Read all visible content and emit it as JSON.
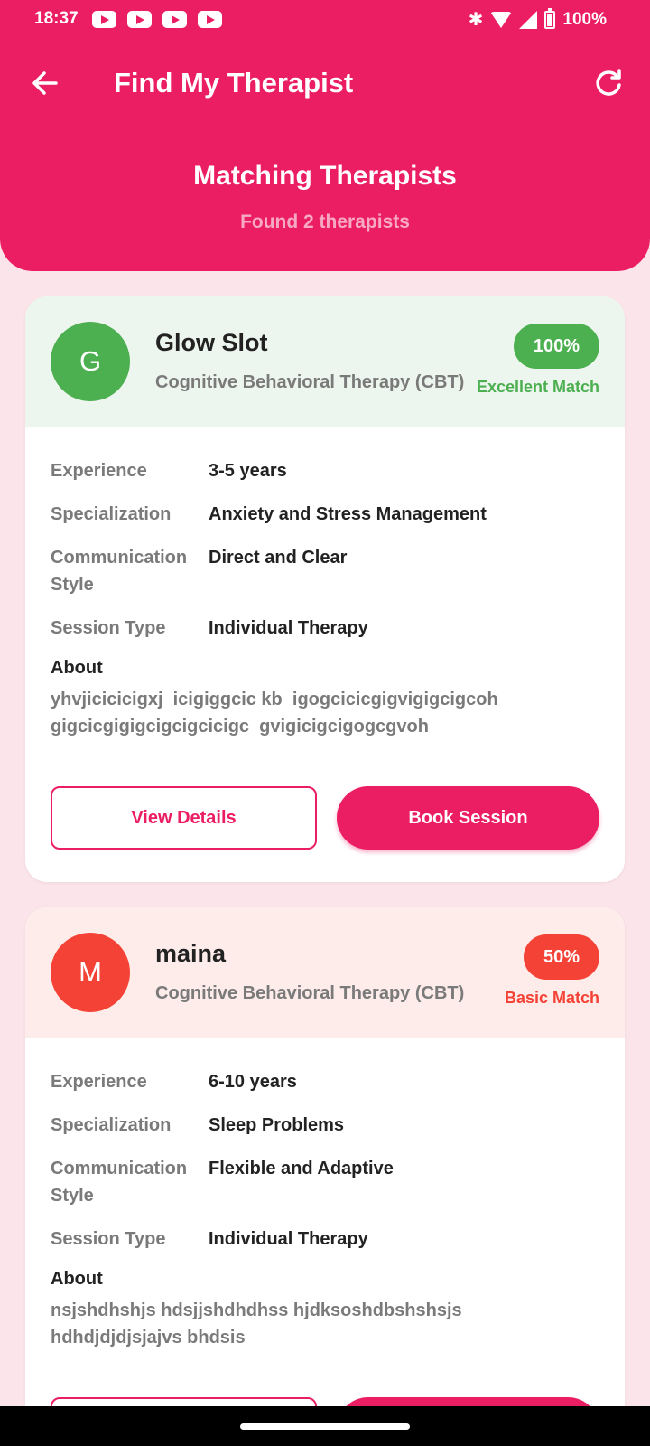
{
  "status_bar": {
    "time": "18:37",
    "battery": "100%"
  },
  "app_bar": {
    "title": "Find My Therapist"
  },
  "header": {
    "title": "Matching Therapists",
    "subtitle": "Found 2 therapists"
  },
  "labels": {
    "experience": "Experience",
    "specialization": "Specialization",
    "communication_style": "Communication\nStyle",
    "session_type": "Session Type",
    "about": "About",
    "view_details": "View Details",
    "book_session": "Book Session"
  },
  "therapists": [
    {
      "initial": "G",
      "name": "Glow Slot",
      "therapy": "Cognitive Behavioral Therapy (CBT)",
      "match_percent": "100%",
      "match_label": "Excellent Match",
      "experience": "3-5 years",
      "specialization": "Anxiety and Stress Management",
      "communication_style": "Direct and Clear",
      "session_type": "Individual Therapy",
      "about": "yhvjicicicigxj  icigiggcic kb  igogcicicgigvigigcigcoh\ngigcicgigigcigcigcicigc  gvigicigcigogcgvoh",
      "colors": {
        "accent": "#4CAF50",
        "top_bg": "#EDF6EE"
      }
    },
    {
      "initial": "M",
      "name": "maina",
      "therapy": "Cognitive Behavioral Therapy (CBT)",
      "match_percent": "50%",
      "match_label": "Basic Match",
      "experience": "6-10 years",
      "specialization": "Sleep Problems",
      "communication_style": "Flexible and Adaptive",
      "session_type": "Individual Therapy",
      "about": "nsjshdhshjs hdsjjshdhdhss hjdksoshdbshshsjs\nhdhdjdjdjsjajvs bhdsis",
      "colors": {
        "accent": "#F44336",
        "top_bg": "#FDECEA"
      }
    }
  ],
  "icons": {
    "back": "arrow-left-icon",
    "refresh": "refresh-icon"
  },
  "theme": {
    "primary": "#EC1E63",
    "background": "#FBE4EA"
  }
}
